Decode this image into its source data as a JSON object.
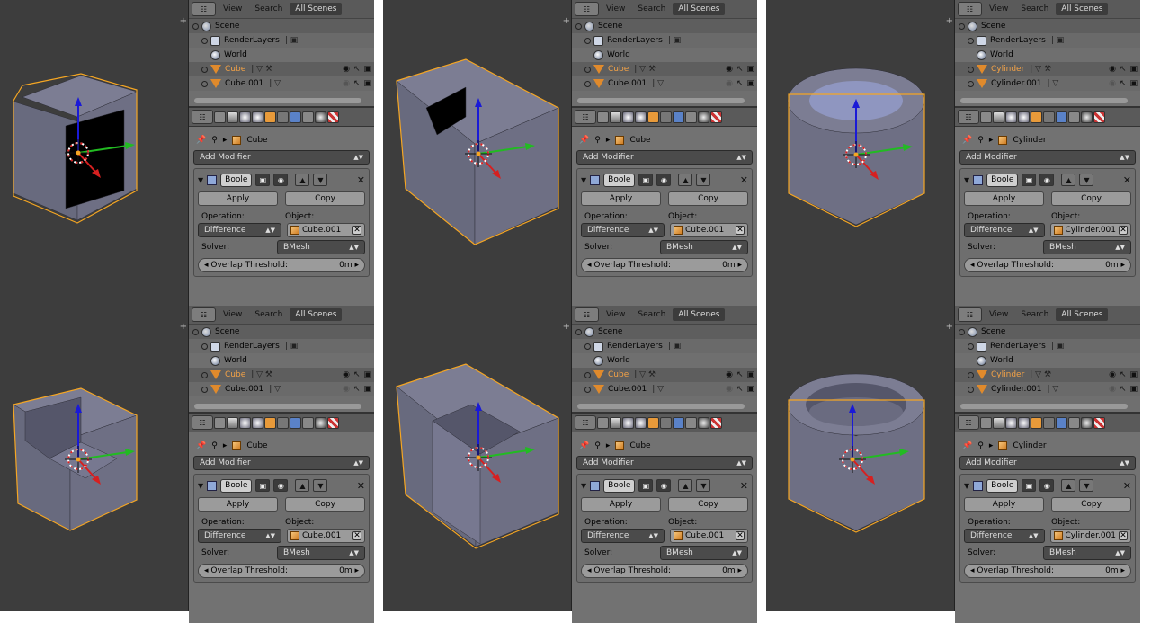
{
  "outliner": {
    "editor_icon": "☷",
    "tabs": [
      "View",
      "Search",
      "All Scenes"
    ],
    "active_tab": 2
  },
  "props": {
    "add_modifier": "Add Modifier",
    "modifier_name": "Boole",
    "apply": "Apply",
    "copy": "Copy",
    "operation_label": "Operation:",
    "object_label": "Object:",
    "operation_value": "Difference",
    "solver_label": "Solver:",
    "solver_value": "BMesh",
    "overlap_label": "Overlap Threshold:",
    "overlap_value": "0m"
  },
  "cells": [
    {
      "scene": "Scene",
      "renderlayers": "RenderLayers",
      "world": "World",
      "obj1": "Cube",
      "obj2": "Cube.001",
      "context": "Cube",
      "target": "Cube.001"
    },
    {
      "scene": "Scene",
      "renderlayers": "RenderLayers",
      "world": "World",
      "obj1": "Cube",
      "obj2": "Cube.001",
      "context": "Cube",
      "target": "Cube.001"
    },
    {
      "scene": "Scene",
      "renderlayers": "RenderLayers",
      "world": "World",
      "obj1": "Cylinder",
      "obj2": "Cylinder.001",
      "context": "Cylinder",
      "target": "Cylinder.001"
    },
    {
      "scene": "Scene",
      "renderlayers": "RenderLayers",
      "world": "World",
      "obj1": "Cube",
      "obj2": "Cube.001",
      "context": "Cube",
      "target": "Cube.001"
    },
    {
      "scene": "Scene",
      "renderlayers": "RenderLayers",
      "world": "World",
      "obj1": "Cube",
      "obj2": "Cube.001",
      "context": "Cube",
      "target": "Cube.001"
    },
    {
      "scene": "Scene",
      "renderlayers": "RenderLayers",
      "world": "World",
      "obj1": "Cylinder",
      "obj2": "Cylinder.001",
      "context": "Cylinder",
      "target": "Cylinder.001"
    }
  ],
  "colors": {
    "viewport_bg": "#3d3d3d",
    "mesh_face": "#6e6f84",
    "mesh_outline": "#f5a623",
    "axis_z": "#1a1ad6",
    "axis_y": "#22bb22",
    "axis_x": "#d62020",
    "selected_text": "#f3a247"
  },
  "icons": [
    "editor-type-icon",
    "scene-icon",
    "renderlayers-icon",
    "world-icon",
    "mesh-icon",
    "wrench-icon",
    "eye-icon",
    "cursor-icon",
    "render-icon",
    "pin-icon",
    "cube-icon",
    "camera-icon",
    "close-icon",
    "arrow-up-icon",
    "arrow-down-icon"
  ]
}
